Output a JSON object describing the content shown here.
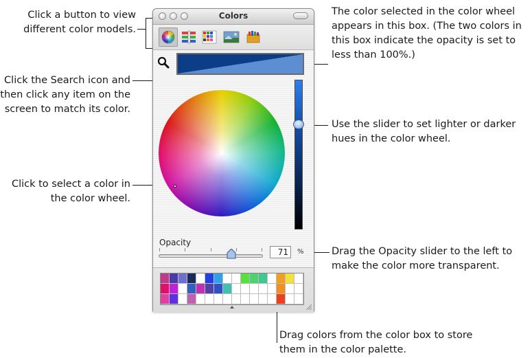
{
  "window": {
    "title": "Colors",
    "mode_buttons": [
      {
        "name": "color-wheel-mode",
        "icon": "color-wheel-icon",
        "selected": true
      },
      {
        "name": "color-sliders-mode",
        "icon": "sliders-icon",
        "selected": false
      },
      {
        "name": "color-palettes-mode",
        "icon": "palette-grid-icon",
        "selected": false
      },
      {
        "name": "image-palettes-mode",
        "icon": "image-icon",
        "selected": false
      },
      {
        "name": "crayons-mode",
        "icon": "crayons-icon",
        "selected": false
      }
    ],
    "search_icon": "magnifier-icon",
    "opacity_label": "Opacity",
    "opacity_value": "71",
    "opacity_unit": "%",
    "opacity_fraction": 0.71,
    "brightness_fraction": 0.74,
    "selected_color_dark": "#0b3e86",
    "selected_color_light": "#5b8fd1",
    "palette": [
      [
        "#c03a8c",
        "#4a3aa8",
        "#6f6fcc",
        "#1c2a5a",
        "",
        "#2040e0",
        "#30a0e8",
        "",
        "",
        "#58e040",
        "#50d070",
        "#40c890",
        "",
        "#f0a020",
        "#f0e040",
        ""
      ],
      [
        "#e01068",
        "#c020d8",
        "",
        "#3060c0",
        "#c030b0",
        "#5040a8",
        "#3050c8",
        "#40c0b0",
        "",
        "",
        "",
        "",
        "",
        "#f09020",
        "",
        ""
      ],
      [
        "#e040a0",
        "#6030e0",
        "",
        "#c060b0",
        "",
        "",
        "",
        "",
        "",
        "",
        "",
        "",
        "",
        "#e84020",
        "",
        ""
      ]
    ]
  },
  "callouts": {
    "mode_buttons": "Click a button to view different color models.",
    "search": "Click the Search icon and then click any item on the screen to match its color.",
    "wheel": "Click to select a color in the color wheel.",
    "swatch": "The color selected in the color wheel appears in this box. (The two colors in this box indicate the opacity is set to less than 100%.)",
    "brightness": "Use the slider to set lighter or darker hues in the color wheel.",
    "opacity": "Drag the Opacity slider to the left to make the color more transparent.",
    "palette": "Drag colors from the color box to store them in the color palette."
  }
}
